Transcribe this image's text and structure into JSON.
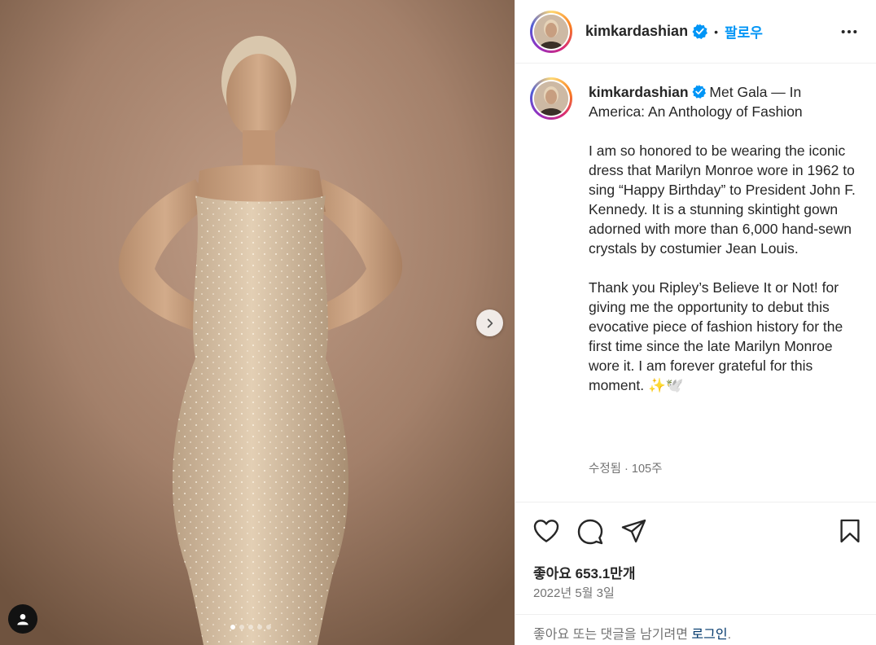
{
  "post": {
    "carousel": {
      "total_slides": 5,
      "active_slide": 1
    }
  },
  "header": {
    "username": "kimkardashian",
    "separator": "•",
    "follow_label": "팔로우"
  },
  "caption": {
    "username": "kimkardashian",
    "text": " Met Gala — In America: An Anthology of Fashion\n\nI am so honored to be wearing the iconic dress that Marilyn Monroe wore in 1962 to sing “Happy Birthday” to President John F. Kennedy. It is a stunning skintight gown adorned with more than 6,000 hand-sewn crystals by costumier Jean Louis.\n\nThank you Ripley’s Believe It or Not! for giving me the opportunity to debut this evocative piece of fashion history for the first time since the late Marilyn Monroe wore it. I am forever grateful for this moment. ✨🕊️",
    "meta": "수정됨 · 105주"
  },
  "stats": {
    "likes_text": "좋아요 653.1만개",
    "date": "2022년 5월 3일"
  },
  "footer": {
    "prompt_text": "좋아요 또는 댓글을 남기려면 ",
    "login_label": "로그인",
    "period": "."
  },
  "icons": {
    "verified": "verified-badge-icon",
    "more": "more-options-icon",
    "like": "heart-icon",
    "comment": "comment-icon",
    "share": "send-icon",
    "save": "bookmark-icon",
    "next": "chevron-right-icon",
    "tagged": "user-icon"
  },
  "colors": {
    "accent": "#0095f6",
    "verified": "#0095f6",
    "secondary_text": "#737373",
    "link": "#00376b"
  }
}
